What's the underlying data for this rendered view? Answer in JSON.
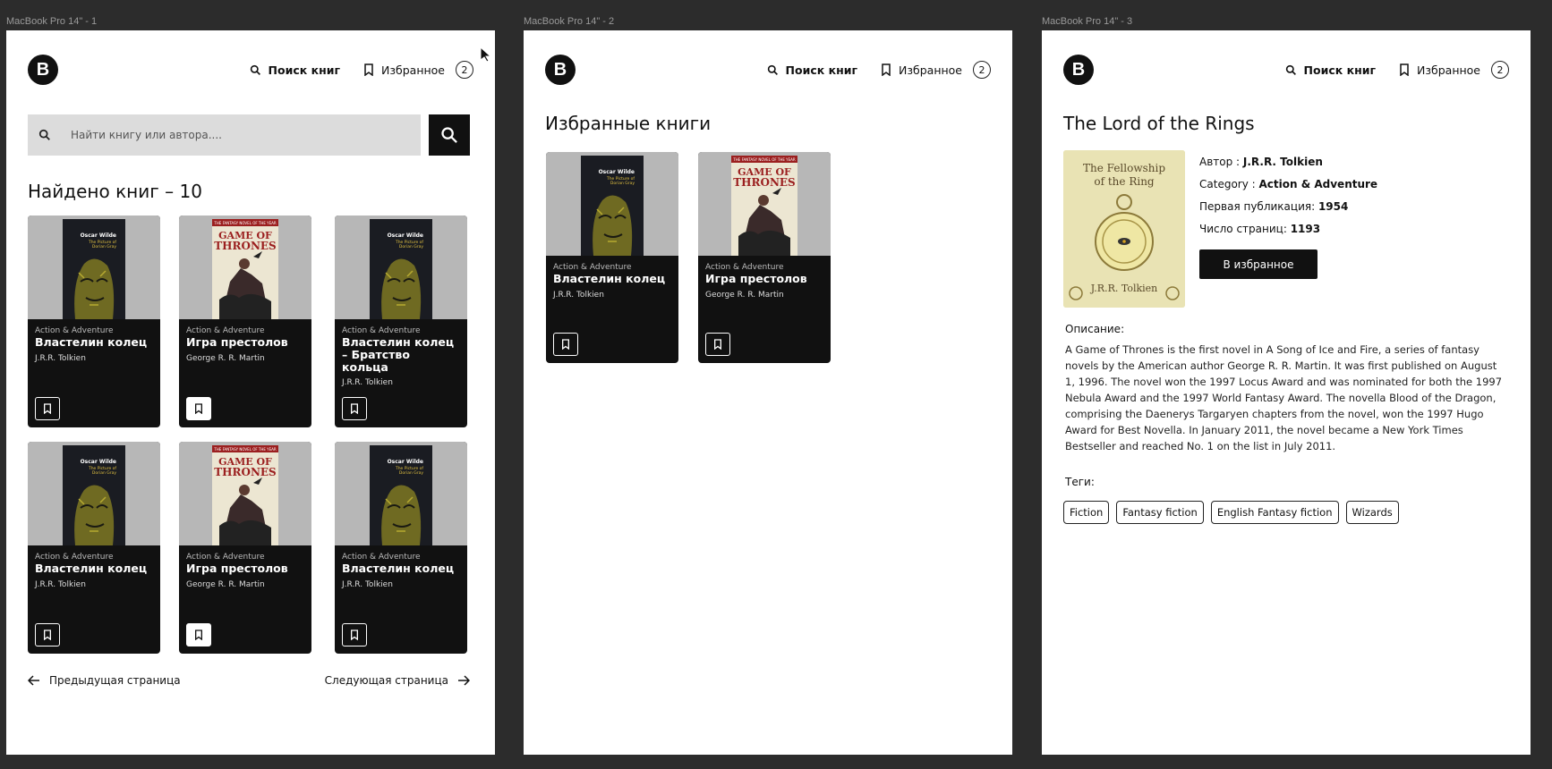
{
  "frames": {
    "f1_label": "MacBook Pro 14\" - 1",
    "f2_label": "MacBook Pro 14\" - 2",
    "f3_label": "MacBook Pro 14\" - 3"
  },
  "header": {
    "logo": "B",
    "search_label": "Поиск книг",
    "favorites_label": "Избранное",
    "favorites_count": "2"
  },
  "search": {
    "placeholder": "Найти книгу или автора...."
  },
  "results": {
    "title": "Найдено книг – 10",
    "cards": [
      {
        "category": "Action & Adventure",
        "title": "Властелин колец",
        "author": "J.R.R. Tolkien",
        "favorite": false
      },
      {
        "category": "Action & Adventure",
        "title": "Игра престолов",
        "author": "George R. R. Martin",
        "favorite": true
      },
      {
        "category": "Action & Adventure",
        "title": "Властелин колец – Братство кольца",
        "author": "J.R.R. Tolkien",
        "favorite": false
      },
      {
        "category": "Action & Adventure",
        "title": "Властелин колец",
        "author": "J.R.R. Tolkien",
        "favorite": false
      },
      {
        "category": "Action & Adventure",
        "title": "Игра престолов",
        "author": "George R. R. Martin",
        "favorite": true
      },
      {
        "category": "Action & Adventure",
        "title": "Властелин колец",
        "author": "J.R.R. Tolkien",
        "favorite": false
      }
    ],
    "prev_label": "Предыдущая страница",
    "next_label": "Следующая страница"
  },
  "favorites": {
    "title": "Избранные книги",
    "cards": [
      {
        "category": "Action & Adventure",
        "title": "Властелин колец",
        "author": "J.R.R. Tolkien"
      },
      {
        "category": "Action & Adventure",
        "title": "Игра престолов",
        "author": "George R. R. Martin"
      }
    ]
  },
  "detail": {
    "title": "The Lord of the Rings",
    "cover_title": "The Fellowship of the Ring",
    "cover_author": "J.R.R. Tolkien",
    "author_label": "Автор : ",
    "author": "J.R.R. Tolkien",
    "category_label": "Category : ",
    "category": "Action & Adventure",
    "published_label": "Первая публикация: ",
    "published": "1954",
    "pages_label": "Число страниц: ",
    "pages": "1193",
    "add_button": "В избранное",
    "description_label": "Описание:",
    "description": "A Game of Thrones is the first novel in A Song of Ice and Fire, a series of fantasy novels by the American author George R. R. Martin. It was first published on August 1, 1996. The novel won the 1997 Locus Award and was nominated for both the 1997 Nebula Award and the 1997 World Fantasy Award. The novella Blood of the Dragon, comprising the Daenerys Targaryen chapters from the novel, won the 1997 Hugo Award for Best Novella. In January 2011, the novel became a New York Times Bestseller and reached No. 1 on the list in July 2011.",
    "tags_label": "Теги:",
    "tags": [
      "Fiction",
      "Fantasy fiction",
      "English Fantasy fiction",
      "Wizards"
    ]
  },
  "covers": {
    "dorian_author": "Oscar Wilde",
    "dorian_title": "The Picture of Dorian Gray",
    "got_top": "THE FANTASY NOVEL OF THE YEAR",
    "got_title": "GAME OF THRONES"
  },
  "colors": {
    "frame_bg": "#2c2c2c",
    "card_bg": "#111111",
    "cover_bg": "#b7b7b7",
    "search_bg": "#dcdcdc"
  }
}
